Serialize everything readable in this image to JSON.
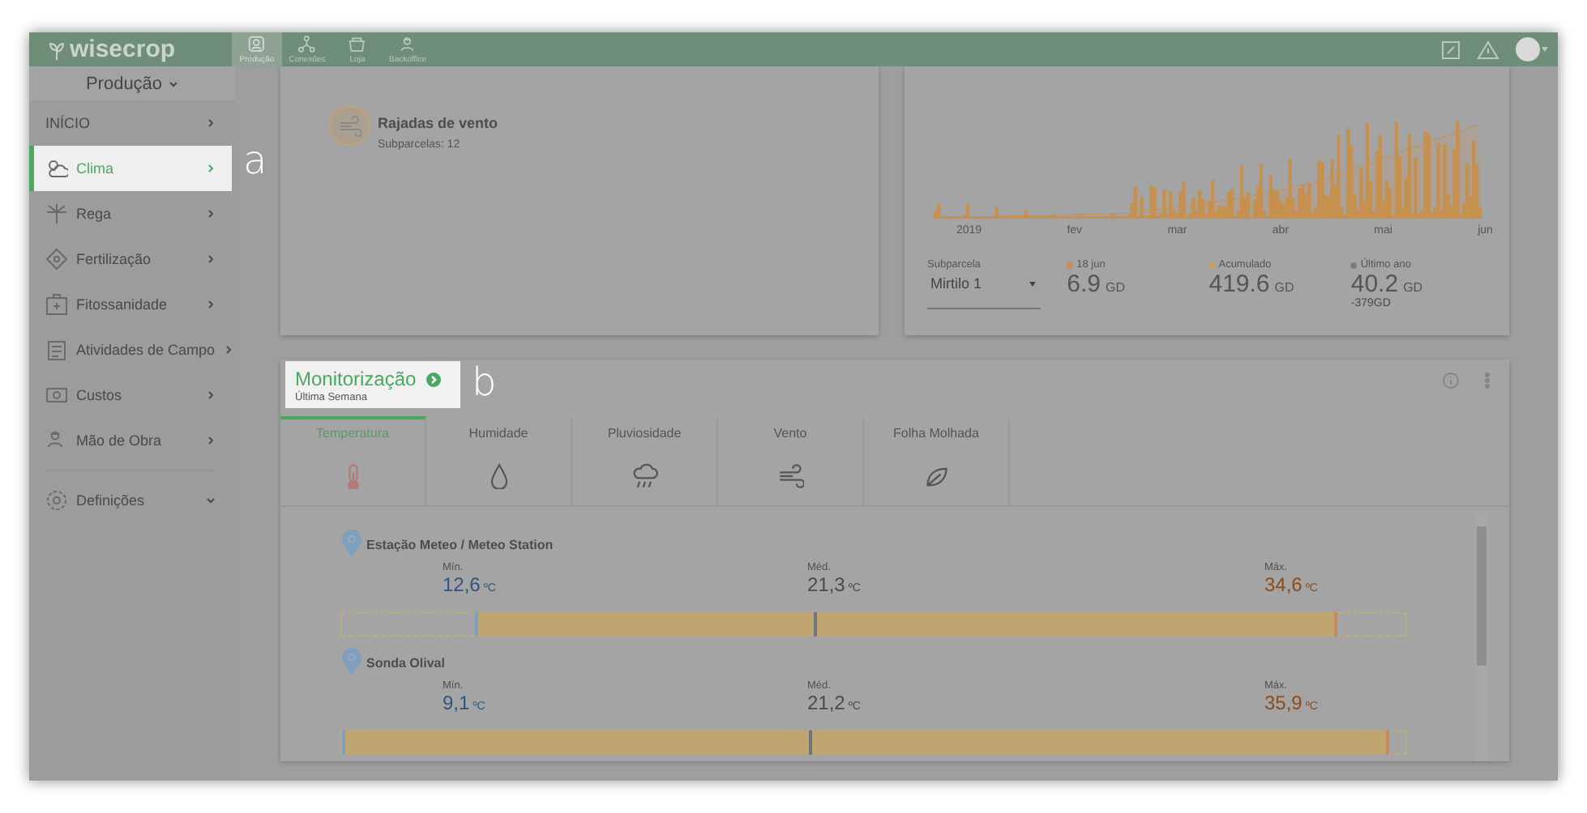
{
  "top_bar": {
    "logo": "wisecrop",
    "nav": [
      {
        "label": "Produção",
        "selected": true
      },
      {
        "label": "Conexões",
        "selected": false
      },
      {
        "label": "Loja",
        "selected": false
      },
      {
        "label": "Backoffice",
        "selected": false
      }
    ]
  },
  "sidebar": {
    "header": "Produção",
    "items": [
      {
        "label": "INÍCIO",
        "kind": "page",
        "selected": false,
        "highlighted": false
      },
      {
        "label": "Clima",
        "kind": "page",
        "selected": true,
        "highlighted": true
      },
      {
        "label": "Rega",
        "kind": "page",
        "selected": false,
        "highlighted": false
      },
      {
        "label": "Fertilização",
        "kind": "page",
        "selected": false,
        "highlighted": false
      },
      {
        "label": "Fitossanidade",
        "kind": "page",
        "selected": false,
        "highlighted": false
      },
      {
        "label": "Atividades de Campo",
        "kind": "page",
        "selected": false,
        "highlighted": false
      },
      {
        "label": "Custos",
        "kind": "page",
        "selected": false,
        "highlighted": false
      },
      {
        "label": "Mão de Obra",
        "kind": "page",
        "selected": false,
        "highlighted": false
      },
      {
        "label": "Definições",
        "kind": "menu",
        "selected": false,
        "highlighted": false
      }
    ]
  },
  "callouts": [
    {
      "label": "a"
    },
    {
      "label": "b"
    }
  ],
  "wind_card": {
    "title": "Rajadas de vento",
    "subtitle": "Subparcelas: 12"
  },
  "gdd_card": {
    "axis_labels": [
      "2019",
      "fev",
      "mar",
      "abr",
      "mai",
      "jun"
    ],
    "subplot": {
      "label": "Subparcela",
      "value": "Mirtilo 1"
    },
    "stats": [
      {
        "label": "18 jun",
        "value": "6.9",
        "unit": "GD",
        "color": "#c98d4f"
      },
      {
        "label": "Acumulado",
        "value": "419.6",
        "unit": "GD",
        "color": "#c9a070"
      },
      {
        "label": "Último ano",
        "value": "40.2",
        "unit": "GD",
        "note": "-379GD",
        "color": "#7d7d7d"
      }
    ]
  },
  "monitor_card": {
    "title": "Monitorização",
    "subtitle": "Última Semana",
    "highlighted": true,
    "tabs": [
      {
        "label": "Temperatura",
        "selected": true
      },
      {
        "label": "Humidade",
        "selected": false
      },
      {
        "label": "Pluviosidade",
        "selected": false
      },
      {
        "label": "Vento",
        "selected": false
      },
      {
        "label": "Folha Molhada",
        "selected": false
      }
    ],
    "stations": [
      {
        "name": "Estação Meteo / Meteo Station",
        "values": [
          {
            "label": "Mín.",
            "value": "12,6",
            "unit": "ºC",
            "kind": "min"
          },
          {
            "label": "Méd.",
            "value": "21,3",
            "unit": "ºC",
            "kind": "mid"
          },
          {
            "label": "Máx.",
            "value": "34,6",
            "unit": "ºC",
            "kind": "max"
          }
        ]
      },
      {
        "name": "Sonda Olival",
        "values": [
          {
            "label": "Mín.",
            "value": "9,1",
            "unit": "ºC",
            "kind": "min"
          },
          {
            "label": "Méd.",
            "value": "21,2",
            "unit": "ºC",
            "kind": "mid"
          },
          {
            "label": "Máx.",
            "value": "35,9",
            "unit": "ºC",
            "kind": "max"
          }
        ]
      }
    ]
  }
}
